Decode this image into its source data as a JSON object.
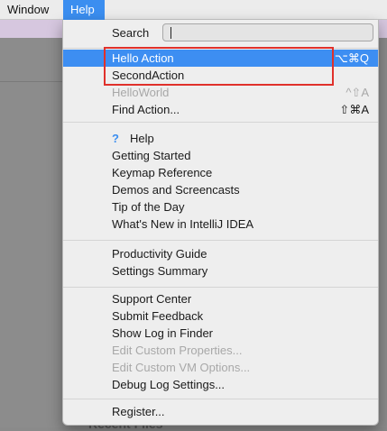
{
  "menubar": {
    "window": "Window",
    "help": "Help"
  },
  "search": {
    "label": "Search"
  },
  "background": {
    "text": "Recent Files"
  },
  "menu": {
    "items": [
      {
        "label": "Hello Action",
        "shortcut": "⌥⌘Q",
        "state": "highlighted"
      },
      {
        "label": "SecondAction",
        "shortcut": "",
        "state": "enabled"
      },
      {
        "label": "HelloWorld",
        "shortcut": "^⇧A",
        "state": "disabled"
      },
      {
        "label": "Find Action...",
        "shortcut": "⇧⌘A",
        "state": "enabled"
      },
      {
        "label": "Help",
        "shortcut": "",
        "state": "enabled",
        "icon": "question-mark-icon"
      },
      {
        "label": "Getting Started",
        "shortcut": "",
        "state": "enabled"
      },
      {
        "label": "Keymap Reference",
        "shortcut": "",
        "state": "enabled"
      },
      {
        "label": "Demos and Screencasts",
        "shortcut": "",
        "state": "enabled"
      },
      {
        "label": "Tip of the Day",
        "shortcut": "",
        "state": "enabled"
      },
      {
        "label": "What's New in IntelliJ IDEA",
        "shortcut": "",
        "state": "enabled"
      },
      {
        "label": "Productivity Guide",
        "shortcut": "",
        "state": "enabled"
      },
      {
        "label": "Settings Summary",
        "shortcut": "",
        "state": "enabled"
      },
      {
        "label": "Support Center",
        "shortcut": "",
        "state": "enabled"
      },
      {
        "label": "Submit Feedback",
        "shortcut": "",
        "state": "enabled"
      },
      {
        "label": "Show Log in Finder",
        "shortcut": "",
        "state": "enabled"
      },
      {
        "label": "Edit Custom Properties...",
        "shortcut": "",
        "state": "disabled"
      },
      {
        "label": "Edit Custom VM Options...",
        "shortcut": "",
        "state": "disabled"
      },
      {
        "label": "Debug Log Settings...",
        "shortcut": "",
        "state": "enabled"
      },
      {
        "label": "Register...",
        "shortcut": "",
        "state": "enabled"
      }
    ]
  },
  "colors": {
    "highlight": "#3d8ef2",
    "annotation": "#e0312b",
    "help_icon": "#3b8ef0"
  }
}
